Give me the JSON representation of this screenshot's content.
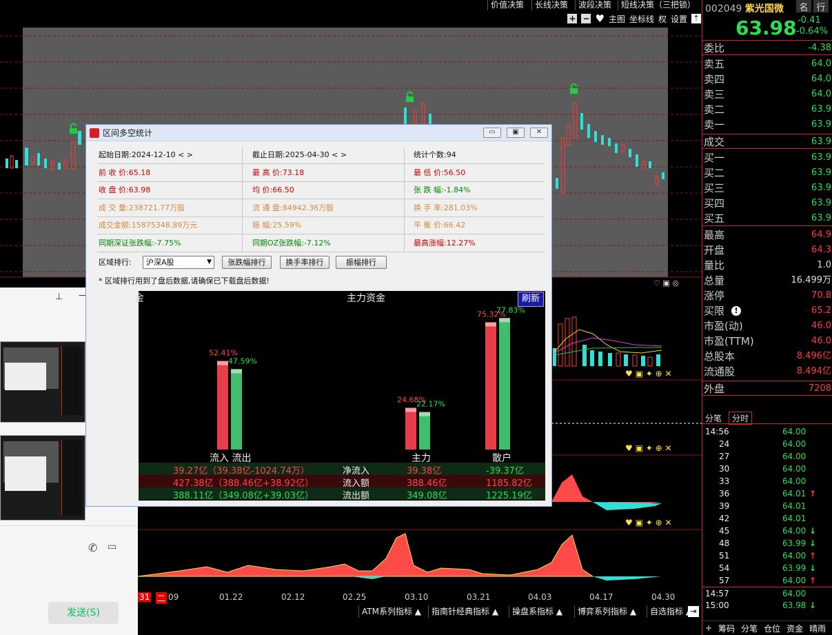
{
  "top_tabs": [
    "价值决策",
    "长线决策",
    "波段决策",
    "短线决策（三把锁）"
  ],
  "toolbar": {
    "zhutu": "主图",
    "zuobiaoxian": "坐标线",
    "quan": "权",
    "shezhi": "设置"
  },
  "quote": {
    "code": "002049",
    "name": "紫光国微",
    "btn_name": "名",
    "btn_row": "行",
    "price": "63.98",
    "change": "-0.41",
    "change_pct": "-0.64%",
    "weibi_label": "委比",
    "weibi_val": "-4.38",
    "sell": [
      {
        "label": "卖五",
        "val": "64.0"
      },
      {
        "label": "卖四",
        "val": "64.0"
      },
      {
        "label": "卖三",
        "val": "64.0"
      },
      {
        "label": "卖二",
        "val": "63.9"
      },
      {
        "label": "卖一",
        "val": "63.9"
      }
    ],
    "chengjiao_label": "成交",
    "chengjiao_val": "63.9",
    "buy": [
      {
        "label": "买一",
        "val": "63.9"
      },
      {
        "label": "买二",
        "val": "63.9"
      },
      {
        "label": "买三",
        "val": "63.9"
      },
      {
        "label": "买四",
        "val": "63.9"
      },
      {
        "label": "买五",
        "val": "63.9"
      }
    ],
    "stats": [
      {
        "label": "最高",
        "val": "64.9",
        "color": "#ff3b3b"
      },
      {
        "label": "开盘",
        "val": "64.3",
        "color": "#ff3b3b"
      },
      {
        "label": "量比",
        "val": "1.0",
        "color": "#e0e0e0"
      },
      {
        "label": "总量",
        "val": "16.499万",
        "color": "#e0e0e0"
      },
      {
        "label": "涨停",
        "val": "70.8",
        "color": "#ff3b3b"
      },
      {
        "label": "买限",
        "val": "65.2",
        "color": "#ff3b3b"
      },
      {
        "label": "市盈(动)",
        "val": "46.0",
        "color": "#ff3b3b"
      },
      {
        "label": "市盈(TTM)",
        "val": "46.0",
        "color": "#ff3b3b"
      },
      {
        "label": "总股本",
        "val": "8.496亿",
        "color": "#ff3b3b"
      },
      {
        "label": "流通股",
        "val": "8.494亿",
        "color": "#ff3b3b"
      }
    ],
    "waipan_label": "外盘",
    "waipan_val": "7208",
    "tick_tabs": [
      "分笔",
      "分时"
    ],
    "ticks": [
      {
        "t": "14:56",
        "p": "64.00",
        "a": ""
      },
      {
        "t": "24",
        "p": "64.00",
        "a": ""
      },
      {
        "t": "27",
        "p": "64.00",
        "a": ""
      },
      {
        "t": "30",
        "p": "64.00",
        "a": ""
      },
      {
        "t": "33",
        "p": "64.00",
        "a": ""
      },
      {
        "t": "36",
        "p": "64.01",
        "a": "↑"
      },
      {
        "t": "39",
        "p": "64.01",
        "a": ""
      },
      {
        "t": "42",
        "p": "64.01",
        "a": ""
      },
      {
        "t": "45",
        "p": "64.00",
        "a": "↓"
      },
      {
        "t": "48",
        "p": "63.99",
        "a": "↓"
      },
      {
        "t": "51",
        "p": "64.00",
        "a": "↑"
      },
      {
        "t": "54",
        "p": "63.99",
        "a": "↓"
      },
      {
        "t": "57",
        "p": "64.00",
        "a": "↑"
      },
      {
        "t": "14:57",
        "p": "64.00",
        "a": ""
      },
      {
        "t": "15:00",
        "p": "63.98",
        "a": "↓"
      }
    ],
    "bottom_tabs": [
      "+",
      "筹码",
      "分笔",
      "仓位",
      "资金",
      "晴雨"
    ]
  },
  "dialog": {
    "title": "区间多空统计",
    "rows": [
      [
        {
          "t": "起始日期:2024-12-10  < >",
          "c": "#111"
        },
        {
          "t": "截止日期:2025-04-30  < >",
          "c": "#111"
        },
        {
          "t": "统计个数:94",
          "c": "#111"
        }
      ],
      [
        {
          "t": "前 收 价:65.18",
          "c": "#c00"
        },
        {
          "t": "最 高 价:73.18",
          "c": "#c00"
        },
        {
          "t": "最 低 价:56.50",
          "c": "#c00"
        }
      ],
      [
        {
          "t": "收 盘 价:63.98",
          "c": "#c00"
        },
        {
          "t": "均    价:66.50",
          "c": "#c00"
        },
        {
          "t": "张 跌 幅:-1.84%",
          "c": "#080"
        }
      ],
      [
        {
          "t": "成 交 量:238721.77万股",
          "c": "#d48a3a"
        },
        {
          "t": "流 通 盘:84942.36万股",
          "c": "#d48a3a"
        },
        {
          "t": "换 手 率:281.03%",
          "c": "#d48a3a"
        }
      ],
      [
        {
          "t": "成交金额:15875348.89万元",
          "c": "#d48a3a"
        },
        {
          "t": "振    幅:25.59%",
          "c": "#d48a3a"
        },
        {
          "t": "平 衡 价:66.42",
          "c": "#d48a3a"
        }
      ],
      [
        {
          "t": "同期深证张跌幅:-7.75%",
          "c": "#080"
        },
        {
          "t": "同期OZ张跌幅:-7.12%",
          "c": "#080"
        },
        {
          "t": "最高涨幅:12.27%",
          "c": "#c00"
        }
      ]
    ],
    "region_label": "区域排行:",
    "region_select": "沪深A股",
    "btn_zdf": "张跌幅排行",
    "btn_hsl": "换手率排行",
    "btn_zf": "振幅排行",
    "note": "* 区域排行用到了盘后数据,请确保已下载盘后数据!",
    "panel_title": "主力资金",
    "panel_left": "金",
    "refresh": "刷新",
    "bars_labels": [
      "流入 流出",
      "主力",
      "散户"
    ],
    "table": [
      {
        "c1": "39.27亿（39.38亿-1024.74万）",
        "lab": "净流入",
        "c2": "39.38亿",
        "c3": "-39.37亿"
      },
      {
        "c1": "427.38亿（388.46亿+38.92亿）",
        "lab": "流入额",
        "c2": "388.46亿",
        "c3": "1185.82亿"
      },
      {
        "c1": "388.11亿（349.08亿+39.03亿）",
        "lab": "流出额",
        "c2": "349.08亿",
        "c3": "1225.19亿"
      }
    ]
  },
  "chart_data": {
    "type": "bar",
    "title": "主力资金",
    "categories": [
      "流入 流出",
      "主力",
      "散户"
    ],
    "series": [
      {
        "name": "流入",
        "values": [
          52.41,
          24.68,
          75.32
        ],
        "labels": [
          "52.41%",
          "24.68%",
          "75.32%"
        ]
      },
      {
        "name": "流出",
        "values": [
          47.59,
          22.17,
          77.83
        ],
        "labels": [
          "47.59%",
          "22.17%",
          "77.83%"
        ]
      }
    ],
    "ylim": [
      0,
      100
    ]
  },
  "date_axis": [
    "31",
    "二",
    "09",
    "01.22",
    "02.12",
    "02.25",
    "03.10",
    "03.21",
    "04.03",
    "04.17",
    "04.30"
  ],
  "bottom_indicators": [
    "ATM系列指标 ▲",
    "指南针经典指标 ▲",
    "操盘系指标 ▲",
    "博弈系列指标 ▲",
    "自选指标 ▲"
  ],
  "chat": {
    "send": "发送(S)"
  },
  "colors": {
    "up": "#ff3b3b",
    "down": "#2bde55",
    "cyan": "#2fe0d6"
  }
}
